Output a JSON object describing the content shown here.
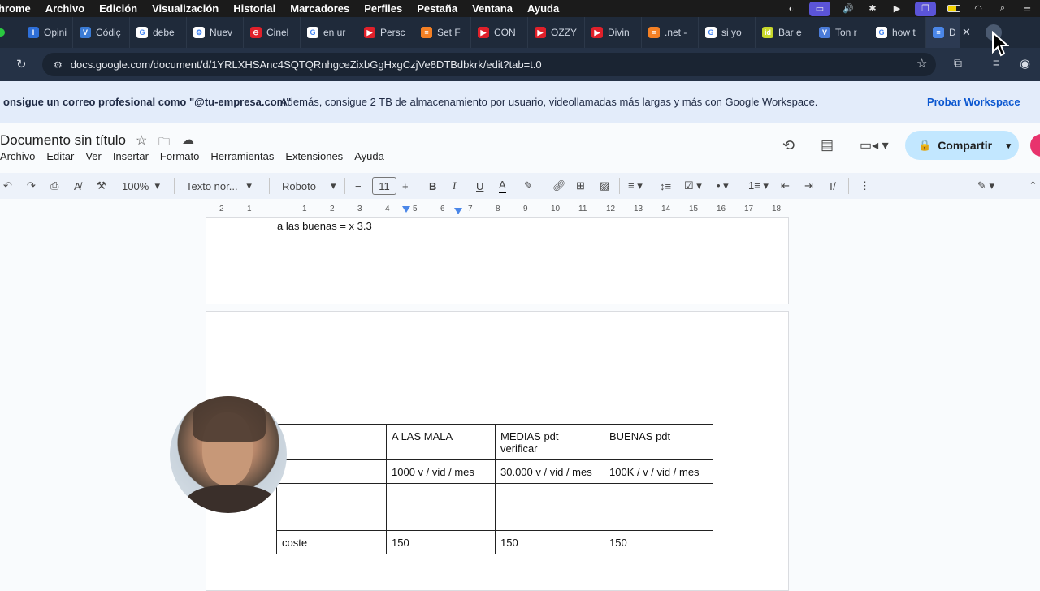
{
  "os_menu": [
    "hrome",
    "Archivo",
    "Edición",
    "Visualización",
    "Historial",
    "Marcadores",
    "Perfiles",
    "Pestaña",
    "Ventana",
    "Ayuda"
  ],
  "tabs": [
    {
      "label": "Opini",
      "color": "#2e6fd8",
      "glyph": "I"
    },
    {
      "label": "Códiç",
      "color": "#3a7bd5",
      "glyph": "V"
    },
    {
      "label": "debe",
      "color": "#ffffff",
      "glyph": "G"
    },
    {
      "label": "Nuev",
      "color": "#ffffff",
      "glyph": "⚙"
    },
    {
      "label": "Cinel",
      "color": "#e0202a",
      "glyph": "⊖"
    },
    {
      "label": "en ur",
      "color": "#ffffff",
      "glyph": "G"
    },
    {
      "label": "Persc",
      "color": "#e0202a",
      "glyph": "▶"
    },
    {
      "label": "Set F",
      "color": "#f48024",
      "glyph": "≡"
    },
    {
      "label": "CON",
      "color": "#e0202a",
      "glyph": "▶"
    },
    {
      "label": "OZZY",
      "color": "#e0202a",
      "glyph": "▶"
    },
    {
      "label": "Divin",
      "color": "#e0202a",
      "glyph": "▶"
    },
    {
      "label": ".net -",
      "color": "#f48024",
      "glyph": "≡"
    },
    {
      "label": "si yo",
      "color": "#ffffff",
      "glyph": "G"
    },
    {
      "label": "Bar e",
      "color": "#c8d82a",
      "glyph": "id"
    },
    {
      "label": "Ton r",
      "color": "#4a7bd8",
      "glyph": "V"
    },
    {
      "label": "how t",
      "color": "#ffffff",
      "glyph": "G"
    },
    {
      "label": "D",
      "color": "#4a86e8",
      "glyph": "≡"
    }
  ],
  "address": {
    "url": "docs.google.com/document/d/1YRLXHSAnc4SQTQRnhgceZixbGgHxgCzjVe8DTBdbkrk/edit?tab=t.0"
  },
  "banner": {
    "promo": "onsigue un correo profesional como \"@tu-empresa.com\"",
    "detail": "Además, consigue 2 TB de almacenamiento por usuario, videollamadas más largas y más con Google Workspace.",
    "cta": "Probar Workspace"
  },
  "doc": {
    "title": "Documento sin título",
    "menus": [
      "Archivo",
      "Editar",
      "Ver",
      "Insertar",
      "Formato",
      "Herramientas",
      "Extensiones",
      "Ayuda"
    ],
    "share": "Compartir"
  },
  "toolbar": {
    "zoom": "100%",
    "style": "Texto nor...",
    "font": "Roboto",
    "font_size": "11"
  },
  "ruler": [
    "2",
    "1",
    "1",
    "2",
    "3",
    "4",
    "5",
    "6",
    "7",
    "8",
    "9",
    "10",
    "11",
    "12",
    "13",
    "14",
    "15",
    "16",
    "17",
    "18"
  ],
  "page1_text": "a las buenas = x 3.3",
  "table": {
    "rows": [
      [
        "",
        "A LAS MALA",
        "MEDIAS pdt\nverificar",
        "BUENAS pdt"
      ],
      [
        "",
        "1000 v / vid / mes",
        "30.000 v / vid / mes",
        "100K / v / vid / mes"
      ],
      [
        "",
        "",
        "",
        ""
      ],
      [
        "",
        "",
        "",
        ""
      ],
      [
        "coste",
        "150",
        "150",
        "150"
      ]
    ]
  },
  "colors": {
    "accent": "#0b57d0",
    "share_bg": "#c2e7ff",
    "banner_bg": "#e3ecfa"
  }
}
